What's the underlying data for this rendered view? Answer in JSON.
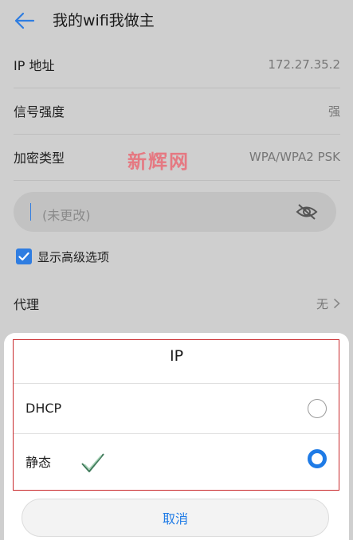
{
  "header": {
    "title": "我的wifi我做主"
  },
  "rows": [
    {
      "label": "IP 地址",
      "value": "172.27.35.2"
    },
    {
      "label": "信号强度",
      "value": "强"
    },
    {
      "label": "加密类型",
      "value": "WPA/WPA2 PSK"
    }
  ],
  "watermark": "新辉网",
  "password": {
    "placeholder": "(未更改)"
  },
  "advanced": {
    "label": "显示高级选项",
    "checked": true
  },
  "proxy": {
    "label": "代理",
    "value": "无"
  },
  "sheet": {
    "title": "IP",
    "options": [
      {
        "label": "DHCP",
        "selected": false
      },
      {
        "label": "静态",
        "selected": true
      }
    ],
    "cancel_label": "取消"
  },
  "colors": {
    "accent": "#1f7be6",
    "highlight_box": "#c9292c",
    "watermark": "#e8707a"
  }
}
